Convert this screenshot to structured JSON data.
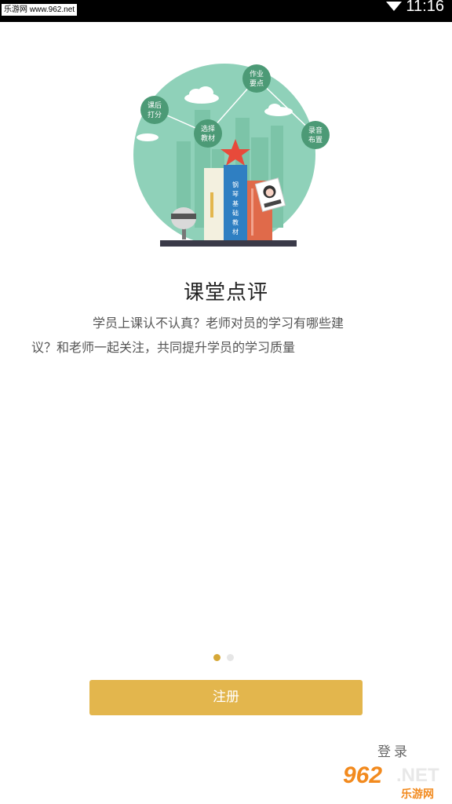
{
  "status_bar": {
    "site_badge": "乐游网 www.962.net",
    "time": "11:16"
  },
  "illustration": {
    "labels": {
      "homework": [
        "作业",
        "要点"
      ],
      "after_class": [
        "课后",
        "打分"
      ],
      "select_material": [
        "选择",
        "教材"
      ],
      "recording": [
        "录音",
        "布置"
      ],
      "book_spine": [
        "钢",
        "琴",
        "基",
        "础",
        "教",
        "材"
      ]
    }
  },
  "onboarding": {
    "title": "课堂点评",
    "description": "学员上课认不认真？老师对员的学习有哪些建议？和老师一起关注，共同提升学员的学习质量",
    "page_index": 1,
    "page_count": 2
  },
  "actions": {
    "register_label": "注册",
    "login_label": "登录"
  },
  "watermark": {
    "number": "962",
    "net": ".NET",
    "cn": "乐游网"
  },
  "colors": {
    "accent": "#e3b64d",
    "teal_background": "#8fd1b9",
    "bubble": "#4c9a76",
    "active_dot": "#d6a838",
    "inactive_dot": "#e6e6e6"
  }
}
